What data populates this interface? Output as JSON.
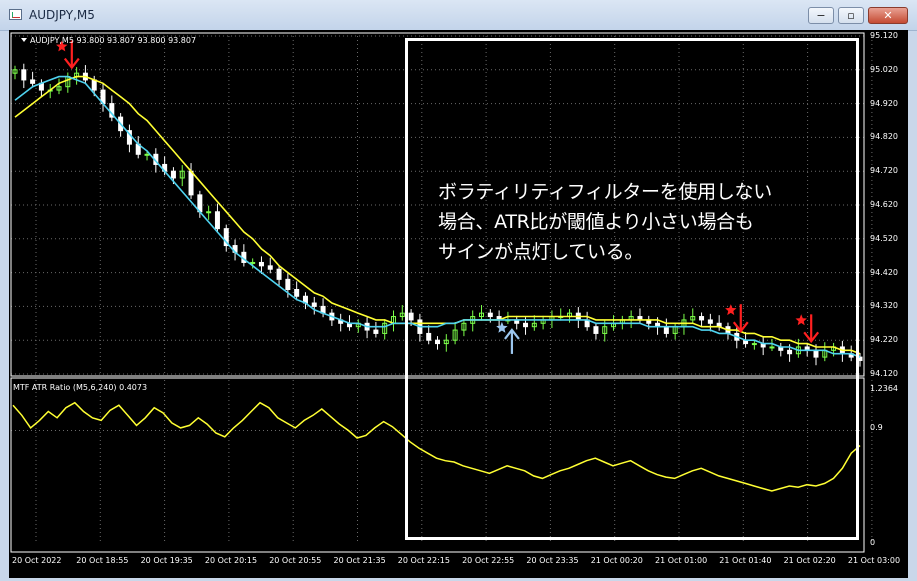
{
  "window": {
    "title": "AUDJPY,M5",
    "minimize_glyph": "−",
    "maximize_glyph": "▫",
    "close_glyph": "✕"
  },
  "chart_header": {
    "ohlc_text": "AUDJPY,M5  93.800 93.807 93.800 93.807"
  },
  "indicator": {
    "label": "MTF ATR Ratio  (M5,6,240) 0.4073"
  },
  "callout": {
    "lines": [
      "ボラティリティフィルターを使用しない",
      "場合、ATR比が閾値より小さい場合も",
      "サインが点灯している。"
    ]
  },
  "colors": {
    "background": "#000000",
    "ma_fast": "#4fd3f0",
    "ma_slow": "#ffff33",
    "indicator_line": "#ffff33",
    "bull": "#7cff4a",
    "bear": "#ffffff",
    "sell_signal": "#ff2020",
    "buy_signal": "#9cc6ee",
    "callout_border": "#ffffff"
  },
  "chart_data": {
    "type": "line",
    "symbol": "AUDJPY",
    "timeframe": "M5",
    "price_axis": {
      "ylim": [
        94.12,
        95.12
      ],
      "ticks": [
        "95.120",
        "95.020",
        "94.920",
        "94.820",
        "94.720",
        "94.620",
        "94.520",
        "94.420",
        "94.320",
        "94.220",
        "94.120"
      ]
    },
    "indicator_axis": {
      "ylim": [
        0,
        1.2364
      ],
      "ticks": [
        "1.2364",
        "0.9",
        "0"
      ]
    },
    "x_ticks": [
      "20 Oct 2022",
      "20 Oct 18:55",
      "20 Oct 19:35",
      "20 Oct 20:15",
      "20 Oct 20:55",
      "20 Oct 21:35",
      "20 Oct 22:15",
      "20 Oct 22:55",
      "20 Oct 23:35",
      "21 Oct 00:20",
      "21 Oct 01:00",
      "21 Oct 01:40",
      "21 Oct 02:20",
      "21 Oct 03:00"
    ],
    "close": [
      95.02,
      94.99,
      94.98,
      94.96,
      94.96,
      94.97,
      95.0,
      95.01,
      94.99,
      94.96,
      94.92,
      94.88,
      94.84,
      94.8,
      94.77,
      94.77,
      94.74,
      94.72,
      94.7,
      94.72,
      94.65,
      94.6,
      94.6,
      94.55,
      94.5,
      94.48,
      94.45,
      94.45,
      94.44,
      94.43,
      94.4,
      94.37,
      94.35,
      94.33,
      94.32,
      94.3,
      94.28,
      94.27,
      94.26,
      94.27,
      94.25,
      94.24,
      94.27,
      94.29,
      94.3,
      94.28,
      94.24,
      94.22,
      94.21,
      94.22,
      94.25,
      94.27,
      94.29,
      94.3,
      94.29,
      94.28,
      94.28,
      94.27,
      94.26,
      94.27,
      94.28,
      94.29,
      94.29,
      94.3,
      94.28,
      94.26,
      94.24,
      94.26,
      94.27,
      94.28,
      94.29,
      94.28,
      94.27,
      94.26,
      94.24,
      94.26,
      94.28,
      94.29,
      94.28,
      94.27,
      94.26,
      94.24,
      94.22,
      94.21,
      94.21,
      94.2,
      94.2,
      94.19,
      94.18,
      94.2,
      94.19,
      94.17,
      94.19,
      94.2,
      94.18,
      94.17,
      94.16
    ],
    "series": [
      {
        "name": "",
        "values": [
          94.93,
          94.95,
          94.97,
          94.98,
          94.99,
          95.0,
          95.0,
          94.99,
          94.98,
          94.95,
          94.92,
          94.89,
          94.86,
          94.83,
          94.8,
          94.78,
          94.75,
          94.72,
          94.69,
          94.66,
          94.63,
          94.6,
          94.57,
          94.54,
          94.51,
          94.48,
          94.46,
          94.44,
          94.42,
          94.4,
          94.38,
          94.36,
          94.34,
          94.33,
          94.31,
          94.3,
          94.29,
          94.28,
          94.27,
          94.27,
          94.26,
          94.26,
          94.26,
          94.27,
          94.27,
          94.27,
          94.26,
          94.26,
          94.26,
          94.27,
          94.27,
          94.28,
          94.28,
          94.28,
          94.28,
          94.28,
          94.28,
          94.28,
          94.28,
          94.28,
          94.28,
          94.28,
          94.28,
          94.28,
          94.28,
          94.28,
          94.27,
          94.27,
          94.27,
          94.27,
          94.27,
          94.27,
          94.26,
          94.26,
          94.26,
          94.26,
          94.26,
          94.26,
          94.25,
          94.25,
          94.24,
          94.24,
          94.23,
          94.22,
          94.22,
          94.21,
          94.21,
          94.2,
          94.2,
          94.19,
          94.19,
          94.19,
          94.19,
          94.18,
          94.18,
          94.18,
          94.17
        ]
      },
      {
        "name": "",
        "values": [
          94.88,
          94.9,
          94.92,
          94.94,
          94.96,
          94.98,
          94.99,
          95.0,
          95.0,
          94.99,
          94.98,
          94.96,
          94.94,
          94.92,
          94.89,
          94.87,
          94.84,
          94.81,
          94.78,
          94.75,
          94.72,
          94.69,
          94.66,
          94.63,
          94.6,
          94.57,
          94.54,
          94.52,
          94.49,
          94.47,
          94.44,
          94.42,
          94.4,
          94.38,
          94.36,
          94.35,
          94.33,
          94.32,
          94.31,
          94.3,
          94.29,
          94.28,
          94.28,
          94.27,
          94.27,
          94.27,
          94.27,
          94.27,
          94.27,
          94.27,
          94.27,
          94.28,
          94.28,
          94.28,
          94.28,
          94.28,
          94.29,
          94.29,
          94.29,
          94.29,
          94.29,
          94.29,
          94.29,
          94.29,
          94.29,
          94.29,
          94.28,
          94.28,
          94.28,
          94.28,
          94.28,
          94.28,
          94.28,
          94.28,
          94.27,
          94.27,
          94.27,
          94.27,
          94.26,
          94.26,
          94.26,
          94.25,
          94.25,
          94.24,
          94.24,
          94.23,
          94.23,
          94.22,
          94.22,
          94.21,
          94.21,
          94.2,
          94.2,
          94.2,
          94.19,
          94.19,
          94.18
        ]
      }
    ],
    "indicator_series": {
      "name": "MTF ATR Ratio",
      "values": [
        1.1,
        1.02,
        0.92,
        0.98,
        1.05,
        1.0,
        1.08,
        1.12,
        1.05,
        1.0,
        0.98,
        1.06,
        1.1,
        1.02,
        0.94,
        1.0,
        1.08,
        1.04,
        0.96,
        0.92,
        0.94,
        1.0,
        0.95,
        0.88,
        0.85,
        0.92,
        0.98,
        1.05,
        1.12,
        1.08,
        1.0,
        0.96,
        0.92,
        0.98,
        1.02,
        1.07,
        1.01,
        0.95,
        0.9,
        0.84,
        0.86,
        0.92,
        0.97,
        0.93,
        0.87,
        0.81,
        0.76,
        0.72,
        0.68,
        0.66,
        0.65,
        0.62,
        0.6,
        0.58,
        0.56,
        0.59,
        0.62,
        0.6,
        0.58,
        0.54,
        0.52,
        0.55,
        0.58,
        0.6,
        0.63,
        0.66,
        0.68,
        0.65,
        0.62,
        0.64,
        0.66,
        0.62,
        0.58,
        0.55,
        0.53,
        0.52,
        0.55,
        0.58,
        0.6,
        0.57,
        0.54,
        0.52,
        0.5,
        0.48,
        0.46,
        0.44,
        0.42,
        0.44,
        0.46,
        0.45,
        0.47,
        0.46,
        0.48,
        0.52,
        0.6,
        0.72,
        0.78
      ]
    },
    "signals": [
      {
        "type": "sell",
        "bar": 6
      },
      {
        "type": "buy",
        "bar": 56
      },
      {
        "type": "sell",
        "bar": 82
      },
      {
        "type": "sell",
        "bar": 90
      }
    ]
  }
}
